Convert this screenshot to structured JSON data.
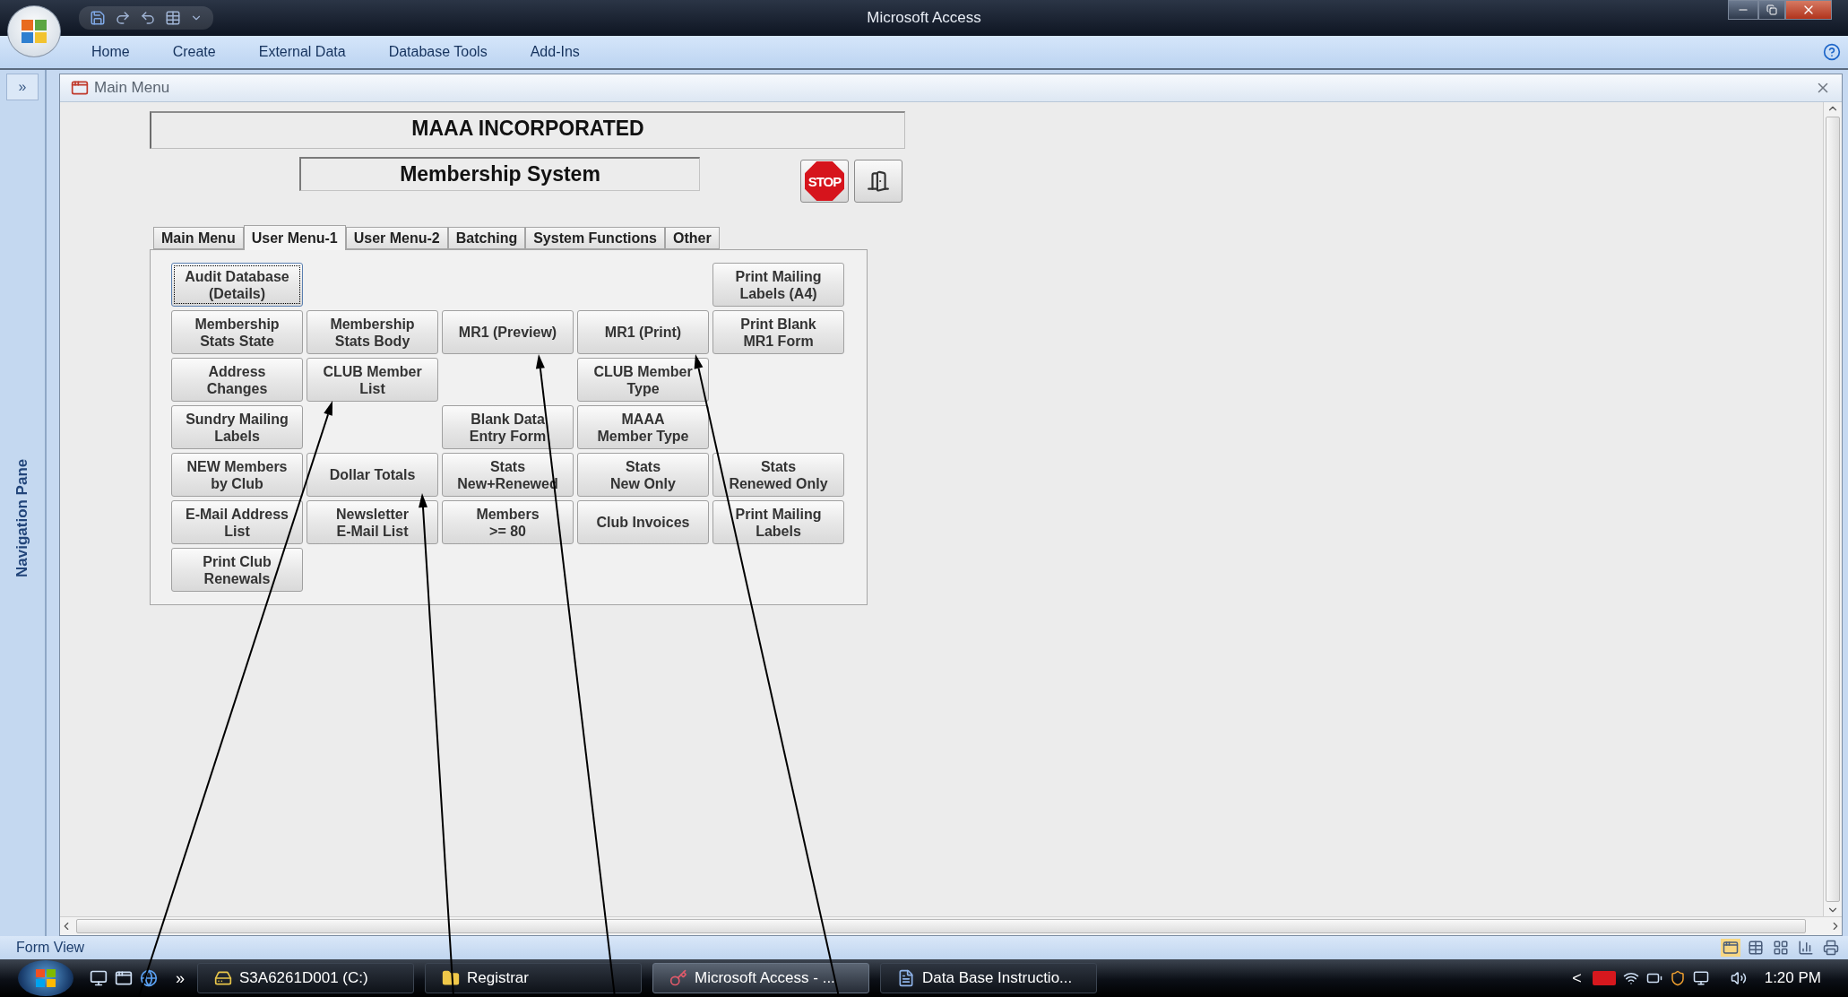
{
  "window": {
    "title": "Microsoft Access"
  },
  "ribbon_tabs": [
    "Home",
    "Create",
    "External Data",
    "Database Tools",
    "Add-Ins"
  ],
  "navigation_pane": {
    "toggle": "»",
    "label": "Navigation Pane"
  },
  "document_tab": {
    "title": "Main Menu"
  },
  "form": {
    "heading": "MAAA INCORPORATED",
    "subheading": "Membership System",
    "stop_button": "STOP",
    "tabs": [
      {
        "label": "Main Menu",
        "selected": false
      },
      {
        "label": "User Menu-1",
        "selected": true
      },
      {
        "label": "User Menu-2",
        "selected": false
      },
      {
        "label": "Batching",
        "selected": false
      },
      {
        "label": "System Functions",
        "selected": false
      },
      {
        "label": "Other",
        "selected": false
      }
    ],
    "button_rows": [
      [
        {
          "kind": "button",
          "label": "Audit Database\n(Details)",
          "focused": true
        },
        {
          "kind": "gap"
        },
        {
          "kind": "gap"
        },
        {
          "kind": "gap"
        },
        {
          "kind": "button",
          "label": "Print Mailing\nLabels (A4)",
          "focused": false
        }
      ],
      [
        {
          "kind": "button",
          "label": "Membership\nStats State",
          "focused": false
        },
        {
          "kind": "button",
          "label": "Membership\nStats Body",
          "focused": false
        },
        {
          "kind": "button",
          "label": "MR1 (Preview)",
          "focused": false
        },
        {
          "kind": "button",
          "label": "MR1 (Print)",
          "focused": false
        },
        {
          "kind": "button",
          "label": "Print Blank\nMR1 Form",
          "focused": false
        }
      ],
      [
        {
          "kind": "button",
          "label": "Address\nChanges",
          "focused": false
        },
        {
          "kind": "button",
          "label": "CLUB Member\nList",
          "focused": false
        },
        {
          "kind": "gap"
        },
        {
          "kind": "button",
          "label": "CLUB Member\nType",
          "focused": false
        },
        {
          "kind": "gap"
        }
      ],
      [
        {
          "kind": "button",
          "label": "Sundry Mailing\nLabels",
          "focused": false
        },
        {
          "kind": "gap"
        },
        {
          "kind": "button",
          "label": "Blank Data\nEntry Form",
          "focused": false
        },
        {
          "kind": "button",
          "label": "MAAA\nMember Type",
          "focused": false
        },
        {
          "kind": "gap"
        }
      ],
      [
        {
          "kind": "button",
          "label": "NEW Members\nby Club",
          "focused": false
        },
        {
          "kind": "button",
          "label": "Dollar Totals",
          "focused": false
        },
        {
          "kind": "button",
          "label": "Stats\nNew+Renewed",
          "focused": false
        },
        {
          "kind": "button",
          "label": "Stats\nNew Only",
          "focused": false
        },
        {
          "kind": "button",
          "label": "Stats\nRenewed Only",
          "focused": false
        }
      ],
      [
        {
          "kind": "button",
          "label": "E-Mail Address\nList",
          "focused": false
        },
        {
          "kind": "button",
          "label": "Newsletter\nE-Mail List",
          "focused": false
        },
        {
          "kind": "button",
          "label": "Members\n>= 80",
          "focused": false
        },
        {
          "kind": "button",
          "label": "Club Invoices",
          "focused": false
        },
        {
          "kind": "button",
          "label": "Print Mailing\nLabels",
          "focused": false
        }
      ],
      [
        {
          "kind": "button",
          "label": "Print Club\nRenewals",
          "focused": false
        },
        {
          "kind": "gap"
        },
        {
          "kind": "gap"
        },
        {
          "kind": "gap"
        },
        {
          "kind": "gap"
        }
      ]
    ]
  },
  "status_bar": {
    "text": "Form View"
  },
  "taskbar": {
    "more": "»",
    "tasks": [
      {
        "kind": "drive",
        "label": "S3A6261D001 (C:)",
        "active": false
      },
      {
        "kind": "folder",
        "label": "Registrar",
        "active": false
      },
      {
        "kind": "access",
        "label": "Microsoft Access - ...",
        "active": true
      },
      {
        "kind": "document",
        "label": "Data Base Instructio...",
        "active": false
      }
    ],
    "tray_expand": "<",
    "clock": "1:20 PM"
  }
}
